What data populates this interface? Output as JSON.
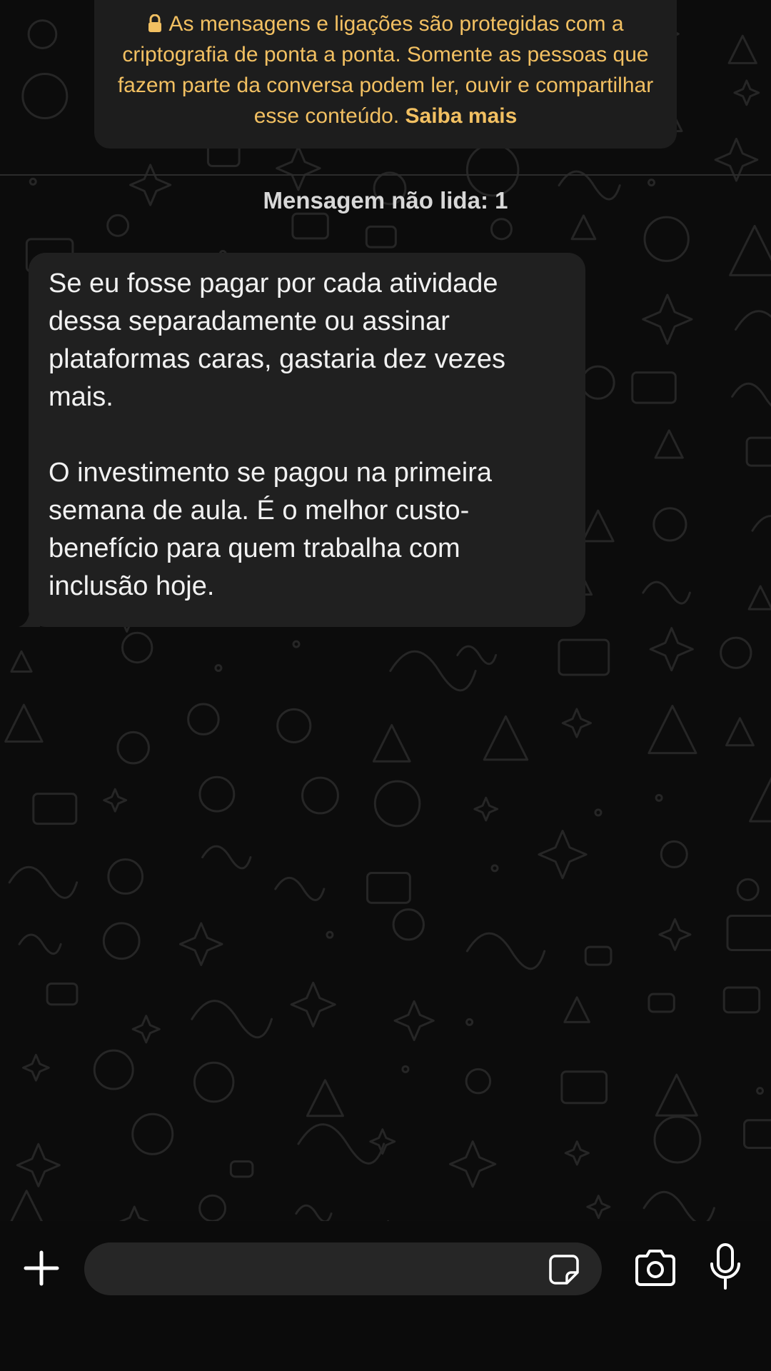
{
  "encryption_notice": {
    "text": "As mensagens e ligações são protegidas com a criptografia de ponta a ponta. Somente as pessoas que fazem parte da conversa podem ler, ouvir e compartilhar esse conteúdo.",
    "link_label": "Saiba mais",
    "icon": "lock-icon",
    "color": "#f2c062"
  },
  "unread_divider": {
    "label": "Mensagem não lida: 1"
  },
  "messages": [
    {
      "direction": "incoming",
      "paragraphs": [
        "Se eu fosse pagar por cada atividade dessa separadamente ou assinar plataformas caras, gastaria dez vezes mais.",
        "O investimento se pagou na primeira semana de aula. É o melhor custo-benefício para quem trabalha com inclusão hoje."
      ]
    }
  ],
  "composer": {
    "input_value": "",
    "placeholder": "",
    "icons": [
      "plus-icon",
      "sticker-icon",
      "camera-icon",
      "microphone-icon"
    ]
  },
  "theme": {
    "background": "#0c0c0c",
    "bubble": "#202020",
    "input": "#262626"
  }
}
